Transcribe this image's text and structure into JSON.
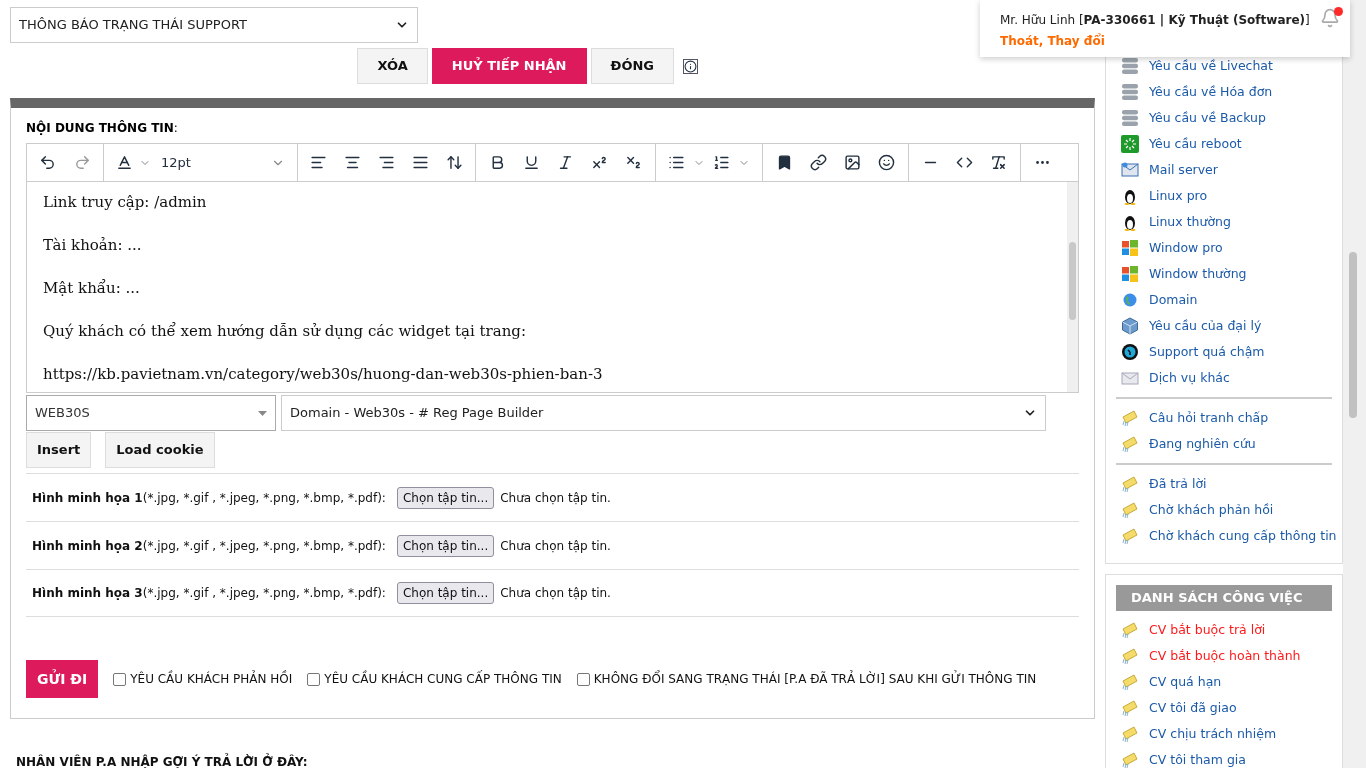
{
  "status_select": {
    "value": "THÔNG BÁO TRẠNG THÁI SUPPORT"
  },
  "actions": [
    {
      "label": "XÓA",
      "kind": "plain"
    },
    {
      "label": "HUỶ TIẾP NHẬN",
      "kind": "primary"
    },
    {
      "label": "ĐÓNG",
      "kind": "plain"
    }
  ],
  "content_label": {
    "bold": "NỘI DUNG THÔNG TIN",
    "rest": ":"
  },
  "editor": {
    "font_size": "12pt",
    "lines": [
      "Link truy cập: /admin",
      "Tài khoản: ...",
      "Mật khẩu: ...",
      "Quý khách có thể xem hướng dẫn sử dụng các widget tại trang:",
      "https://kb.pavietnam.vn/category/web30s/huong-dan-web30s-phien-ban-3"
    ]
  },
  "template": {
    "category": "WEB30S",
    "template": "Domain - Web30s - # Reg Page Builder",
    "buttons": [
      "Insert",
      "Load cookie"
    ]
  },
  "attachments": [
    {
      "label": "Hình minh họa 1",
      "types": "(*.jpg, *.gif , *.jpeg, *.png, *.bmp, *.pdf):",
      "button": "Chọn tập tin...",
      "status": "Chưa chọn tập tin."
    },
    {
      "label": "Hình minh họa 2",
      "types": "(*.jpg, *.gif , *.jpeg, *.png, *.bmp, *.pdf):",
      "button": "Chọn tập tin...",
      "status": "Chưa chọn tập tin."
    },
    {
      "label": "Hình minh họa 3",
      "types": "(*.jpg, *.gif , *.jpeg, *.png, *.bmp, *.pdf):",
      "button": "Chọn tập tin...",
      "status": "Chưa chọn tập tin."
    }
  ],
  "send_button": "GỬI ĐI",
  "options": [
    {
      "label": "YÊU CẦU KHÁCH PHẢN HỒI",
      "checked": false
    },
    {
      "label": "YÊU CẦU KHÁCH CUNG CẤP THÔNG TIN",
      "checked": false
    },
    {
      "label": "KHÔNG ĐỔI SANG TRẠNG THÁI [P.A ĐÃ TRẢ LỜI] SAU KHI GỬI THÔNG TIN",
      "checked": false
    }
  ],
  "footer_heading": "NHÂN VIÊN P.A NHẬP GỢI Ý TRẢ LỜI Ở ĐÂY:",
  "user": {
    "info": "Mr. Hữu Linh [**PA-330661 | Kỹ Thuật (Software)**]",
    "links": [
      "Thoát",
      "Thay đổi"
    ],
    "link_separator": ",",
    "has_notification": true
  },
  "sidebar": {
    "groups": [
      [
        {
          "label": "Yêu cầu về Livechat",
          "kind": "server",
          "urgent": false
        },
        {
          "label": "Yêu cầu về Hóa đơn",
          "kind": "server",
          "urgent": false
        },
        {
          "label": "Yêu cầu về Backup",
          "kind": "server",
          "urgent": false
        },
        {
          "label": "Yêu cầu reboot",
          "kind": "reboot",
          "urgent": false
        },
        {
          "label": "Mail server",
          "kind": "mail",
          "urgent": false
        },
        {
          "label": "Linux pro",
          "kind": "penguin",
          "urgent": false
        },
        {
          "label": "Linux thường",
          "kind": "penguin",
          "urgent": false
        },
        {
          "label": "Window pro",
          "kind": "windows",
          "urgent": false
        },
        {
          "label": "Window thường",
          "kind": "windows",
          "urgent": false
        },
        {
          "label": "Domain",
          "kind": "globe",
          "urgent": false
        },
        {
          "label": "Yêu cầu của đại lý",
          "kind": "cube",
          "urgent": false
        },
        {
          "label": "Support quá chậm",
          "kind": "clock",
          "urgent": false
        },
        {
          "label": "Dịch vụ khác",
          "kind": "envelope",
          "urgent": false
        }
      ],
      [
        {
          "label": "Câu hỏi tranh chấp",
          "kind": "note",
          "urgent": false
        },
        {
          "label": "Đang nghiên cứu",
          "kind": "note",
          "urgent": false
        }
      ],
      [
        {
          "label": "Đã trả lời",
          "kind": "note",
          "urgent": false
        },
        {
          "label": "Chờ khách phản hồi",
          "kind": "note",
          "urgent": false
        },
        {
          "label": "Chờ khách cung cấp thông tin",
          "kind": "note",
          "urgent": false
        }
      ]
    ]
  },
  "tasks": {
    "title": "DANH SÁCH CÔNG VIỆC",
    "items": [
      {
        "label": "CV bắt buộc trả lời",
        "kind": "note",
        "urgent": true
      },
      {
        "label": "CV bắt buộc hoàn thành",
        "kind": "note",
        "urgent": true
      },
      {
        "label": "CV quá hạn",
        "kind": "note",
        "urgent": false
      },
      {
        "label": "CV tôi đã giao",
        "kind": "note",
        "urgent": false
      },
      {
        "label": "CV chịu trách nhiệm",
        "kind": "note",
        "urgent": false
      },
      {
        "label": "CV tôi tham gia",
        "kind": "note",
        "urgent": false
      }
    ]
  }
}
